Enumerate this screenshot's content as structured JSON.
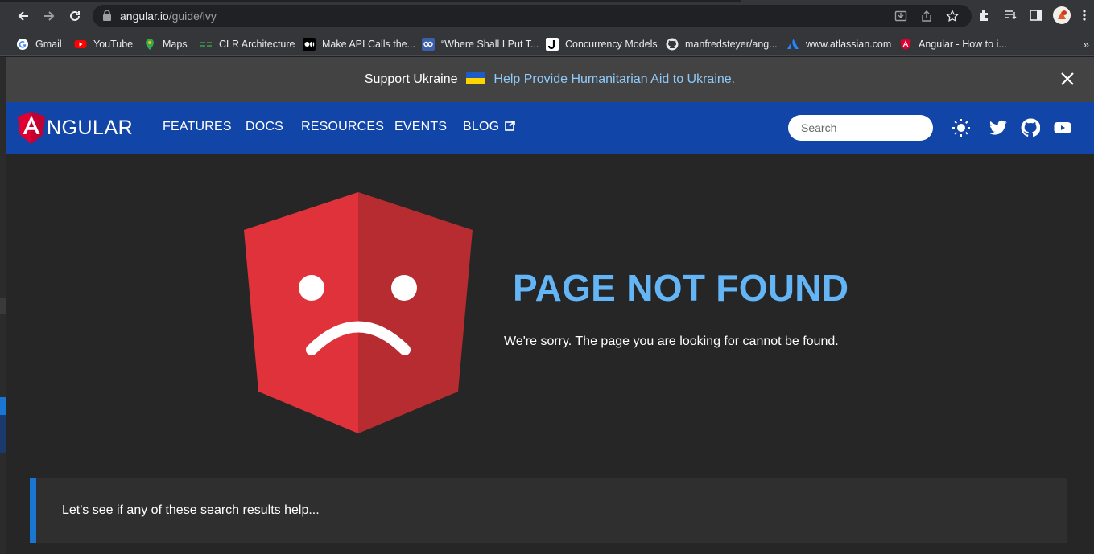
{
  "browser": {
    "url_host": "angular.io",
    "url_path": "/guide/ivy",
    "bookmarks": [
      {
        "label": "Gmail",
        "icon": "google-icon"
      },
      {
        "label": "YouTube",
        "icon": "youtube-icon"
      },
      {
        "label": "Maps",
        "icon": "maps-pin-icon"
      },
      {
        "label": "CLR Architecture",
        "icon": "clr-icon"
      },
      {
        "label": "Make API Calls the...",
        "icon": "medium-icon"
      },
      {
        "label": "“Where Shall I Put T...",
        "icon": "codelink-icon"
      },
      {
        "label": "Concurrency Models",
        "icon": "j-icon"
      },
      {
        "label": "manfredsteyer/ang...",
        "icon": "github-icon"
      },
      {
        "label": "www.atlassian.com",
        "icon": "atlassian-icon"
      },
      {
        "label": "Angular - How to i...",
        "icon": "angular-icon"
      }
    ],
    "more_label": "»"
  },
  "banner": {
    "text": "Support Ukraine",
    "link": "Help Provide Humanitarian Aid to Ukraine."
  },
  "nav": {
    "logo_text": "NGULAR",
    "links": [
      "FEATURES",
      "DOCS",
      "RESOURCES",
      "EVENTS",
      "BLOG"
    ],
    "search_placeholder": "Search"
  },
  "main": {
    "heading": "PAGE NOT FOUND",
    "message": "We're sorry. The page you are looking for cannot be found.",
    "callout": "Let's see if any of these search results help..."
  },
  "colors": {
    "nav_bg": "#1245a8",
    "heading": "#64b5f6",
    "link": "#90caf9",
    "angular_red": "#dd3030",
    "callout_border": "#1976d2"
  }
}
